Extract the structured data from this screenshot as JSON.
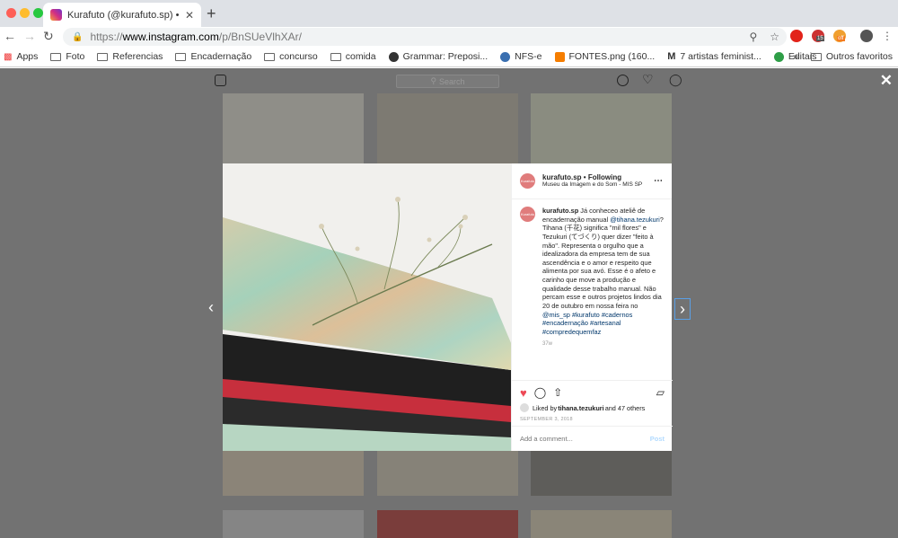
{
  "browser": {
    "tab_title": "Kurafuto (@kurafuto.sp) • Insta",
    "tab_close": "✕",
    "new_tab": "+",
    "url_scheme": "https://",
    "url_host": "www.instagram.com",
    "url_path": "/p/BnSUeVlhXAr/",
    "ext_badge_1": "15",
    "ext_badge_2": "off"
  },
  "bookmarks": {
    "items": [
      {
        "label": "Apps",
        "icon": "apps-grid-icon"
      },
      {
        "label": "Foto",
        "icon": "folder-icon"
      },
      {
        "label": "Referencias",
        "icon": "folder-icon"
      },
      {
        "label": "Encadernação",
        "icon": "folder-icon"
      },
      {
        "label": "concurso",
        "icon": "folder-icon"
      },
      {
        "label": "comida",
        "icon": "folder-icon"
      },
      {
        "label": "Grammar: Preposi...",
        "icon": "globe-icon"
      },
      {
        "label": "NFS-e",
        "icon": "nfse-icon"
      },
      {
        "label": "FONTES.png (160...",
        "icon": "blogger-icon"
      },
      {
        "label": "7 artistas feminist...",
        "icon": "medium-icon"
      },
      {
        "label": "Editais",
        "icon": "check-icon"
      }
    ],
    "overflow": "»",
    "other_label": "Outros favoritos"
  },
  "instagram": {
    "search_placeholder": "Search"
  },
  "post": {
    "username": "kurafuto.sp",
    "follow_state": "Following",
    "location": "Museu da Imagem e do Som - MIS SP",
    "caption_user": "kurafuto.sp",
    "caption_1": " Já conheceo ateliê de encadernação manual ",
    "mention_1": "@tihana.tezukuri",
    "caption_2": "? Tihana (千花) significa \"mil flores\" e Tezukuri (てづくり) quer dizer \"feito à mão\". Representa o orgulho que a idealizadora da empresa tem de sua ascendência e o amor e respeito que alimenta por sua avó. Esse é o afeto e carinho que move a produção e qualidade desse trabalho manual. Não percam esse e outros projetos lindos dia 20 de outubro em nossa feira no ",
    "mention_2": "@mis_sp",
    "hashtags": " #kurafuto #cadernos #encadernação #artesanal #compredequemfaz",
    "age": "37w",
    "likes_prefix": "Liked by ",
    "likes_user": "tihana.tezukuri",
    "likes_suffix": " and 47 others",
    "date": "SEPTEMBER 3, 2018",
    "comment_placeholder": "Add a comment...",
    "post_button": "Post",
    "avatar_text": "Kurafuto"
  },
  "colors": {
    "heart": "#ed4956",
    "link": "#00376b",
    "overlay": "#727272"
  }
}
